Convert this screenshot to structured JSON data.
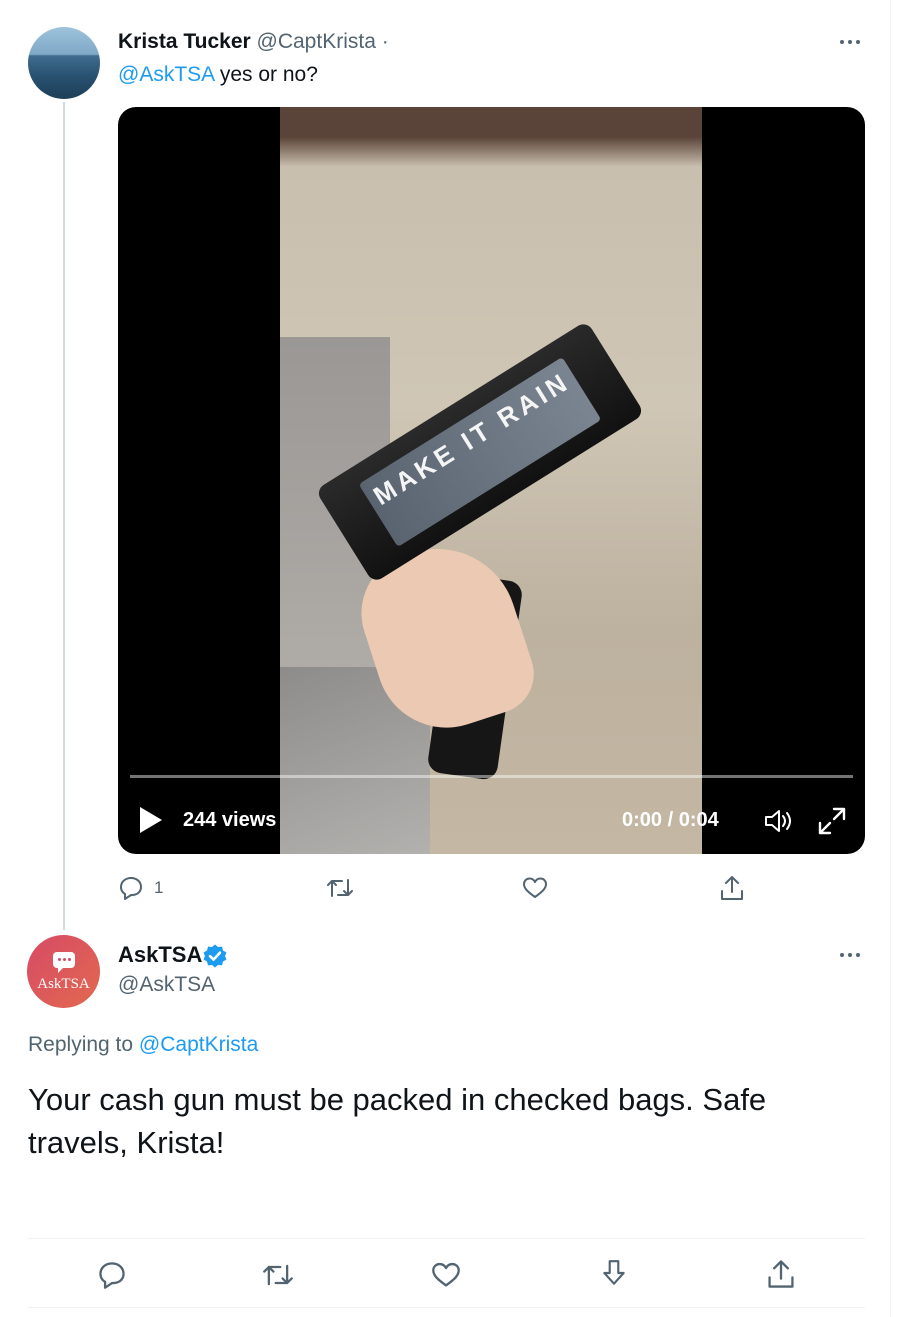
{
  "tweet1": {
    "author_name": "Krista Tucker",
    "author_handle": "@CaptKrista",
    "separator": "·",
    "mention": "@AskTSA",
    "text": " yes or no?",
    "video": {
      "overlay_text": "MAKE IT RAIN",
      "views": "244 views",
      "time": "0:00 / 0:04",
      "progress": 0
    },
    "actions": {
      "reply_count": "1"
    }
  },
  "tweet2": {
    "avatar_text": "AskTSA",
    "author_name": "AskTSA",
    "author_handle": "@AskTSA",
    "replying_prefix": "Replying to ",
    "replying_handle": "@CaptKrista",
    "text": "Your cash gun must be packed in checked bags. Safe travels, Krista!"
  },
  "colors": {
    "link": "#1d9bf0",
    "secondary_text": "#536471",
    "primary_text": "#0f1419",
    "verified": "#1d9bf0"
  },
  "icons": {
    "more": "more-icon",
    "reply": "reply-icon",
    "retweet": "retweet-icon",
    "like": "like-icon",
    "share": "share-icon",
    "bookmark": "bookmark-icon",
    "play": "play-icon",
    "volume": "volume-icon",
    "fullscreen": "fullscreen-icon",
    "verified": "verified-badge-icon"
  }
}
